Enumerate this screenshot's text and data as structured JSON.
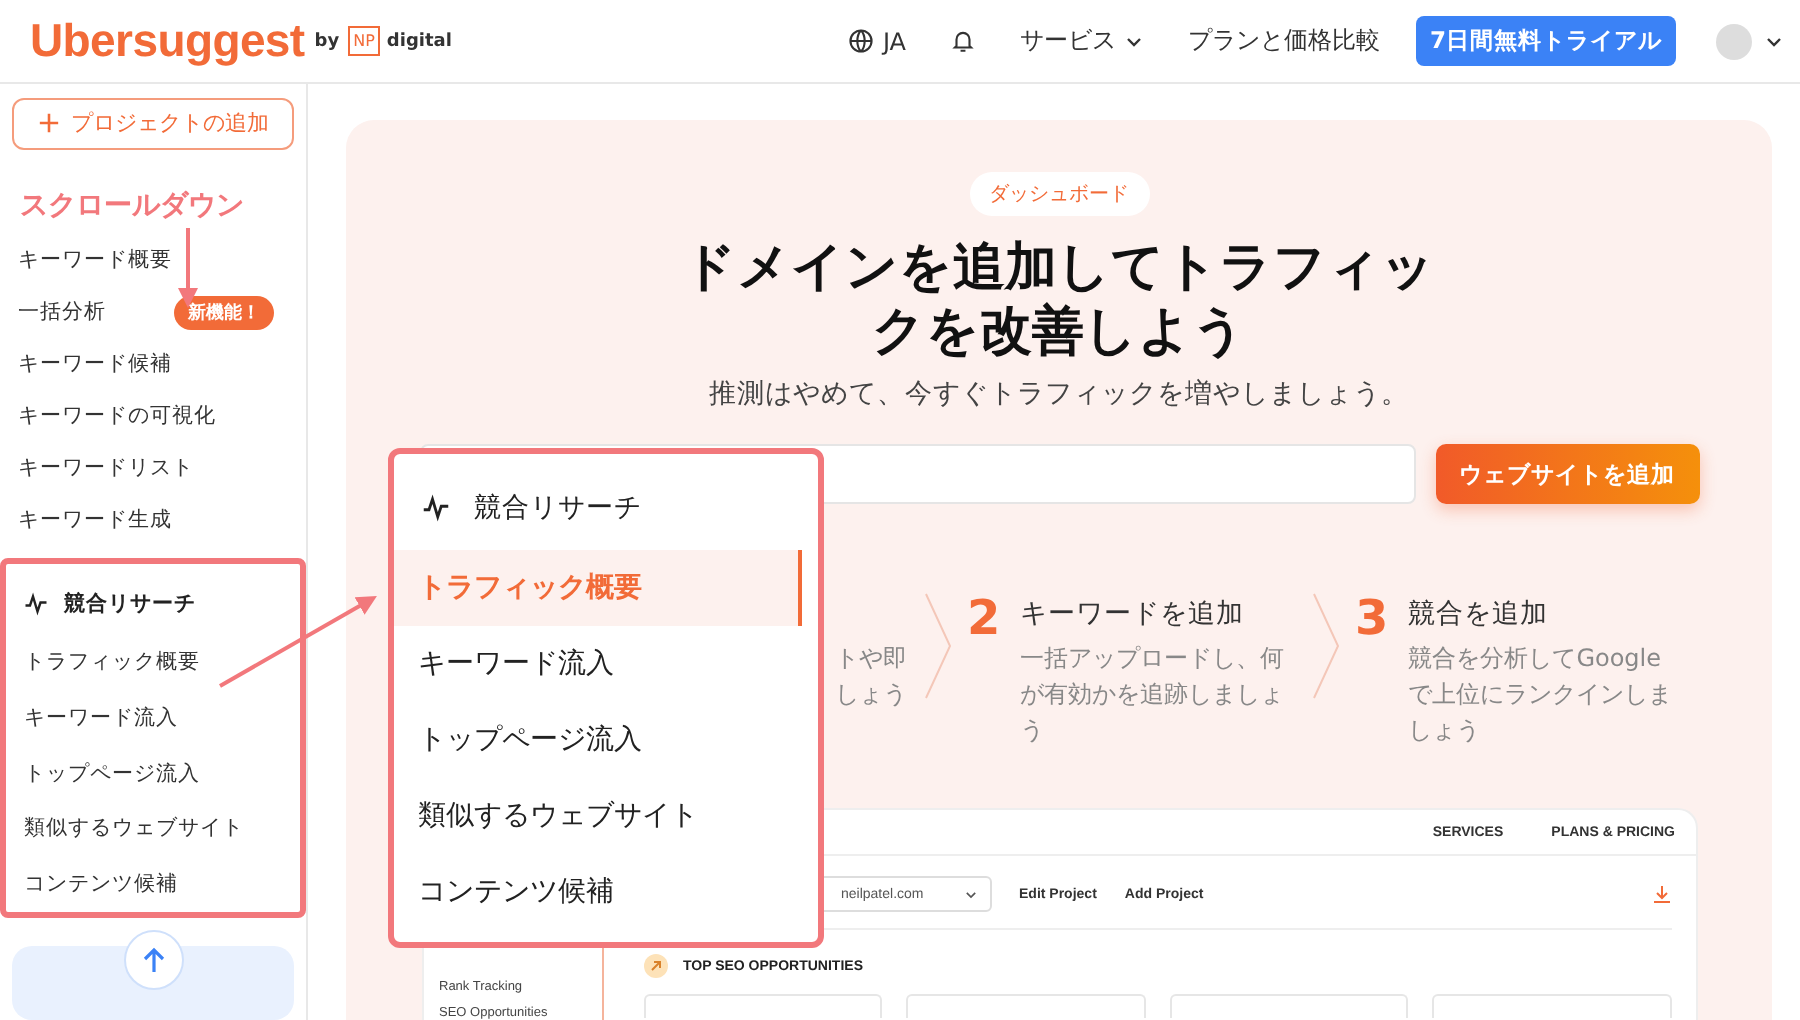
{
  "header": {
    "logo": "Ubersuggest",
    "by": "by",
    "np": "NP",
    "digital": "digital",
    "language": "JA",
    "nav": [
      {
        "label": "サービス",
        "dropdown": true
      },
      {
        "label": "プランと価格比較",
        "dropdown": false
      }
    ],
    "trial_button": "7日間無料トライアル"
  },
  "sidebar": {
    "add_project": "プロジェクトの追加",
    "items": [
      {
        "label": "キーワード概要"
      },
      {
        "label": "一括分析",
        "badge": "新機能！"
      },
      {
        "label": "キーワード候補"
      },
      {
        "label": "キーワードの可視化"
      },
      {
        "label": "キーワードリスト"
      },
      {
        "label": "キーワード生成"
      }
    ],
    "section": {
      "title": "競合リサーチ",
      "items": [
        {
          "label": "トラフィック概要"
        },
        {
          "label": "キーワード流入"
        },
        {
          "label": "トップページ流入"
        },
        {
          "label": "類似するウェブサイト"
        },
        {
          "label": "コンテンツ候補"
        }
      ]
    }
  },
  "annotation": {
    "scroll_label": "スクロールダウン"
  },
  "hero": {
    "tag": "ダッシュボード",
    "title": "ドメインを追加してトラフィックを改善しよう",
    "subtitle": "推測はやめて、今すぐトラフィックを増やしましょう。",
    "add_button": "ウェブサイトを追加",
    "steps": [
      {
        "lines": [
          "トや即",
          "しょう"
        ]
      },
      {
        "number": "2",
        "title": "キーワードを追加",
        "lines": [
          "一括アップロードし、何が有効かを追跡しましょう"
        ]
      },
      {
        "number": "3",
        "title": "競合を追加",
        "lines": [
          "競合を分析してGoogleで上位にランクインしましょう"
        ]
      }
    ]
  },
  "preview": {
    "nav": [
      "SERVICES",
      "PLANS & PRICING"
    ],
    "domain": "neilpatel.com",
    "actions": [
      "Edit Project",
      "Add Project"
    ],
    "side_items": [
      "Rank Tracking",
      "SEO Opportunities"
    ],
    "section_title": "TOP SEO OPPORTUNITIES"
  },
  "popup": {
    "title": "競合リサーチ",
    "items": [
      {
        "label": "トラフィック概要",
        "selected": true
      },
      {
        "label": "キーワード流入",
        "selected": false
      },
      {
        "label": "トップページ流入",
        "selected": false
      },
      {
        "label": "類似するウェブサイト",
        "selected": false
      },
      {
        "label": "コンテンツ候補",
        "selected": false
      }
    ]
  }
}
